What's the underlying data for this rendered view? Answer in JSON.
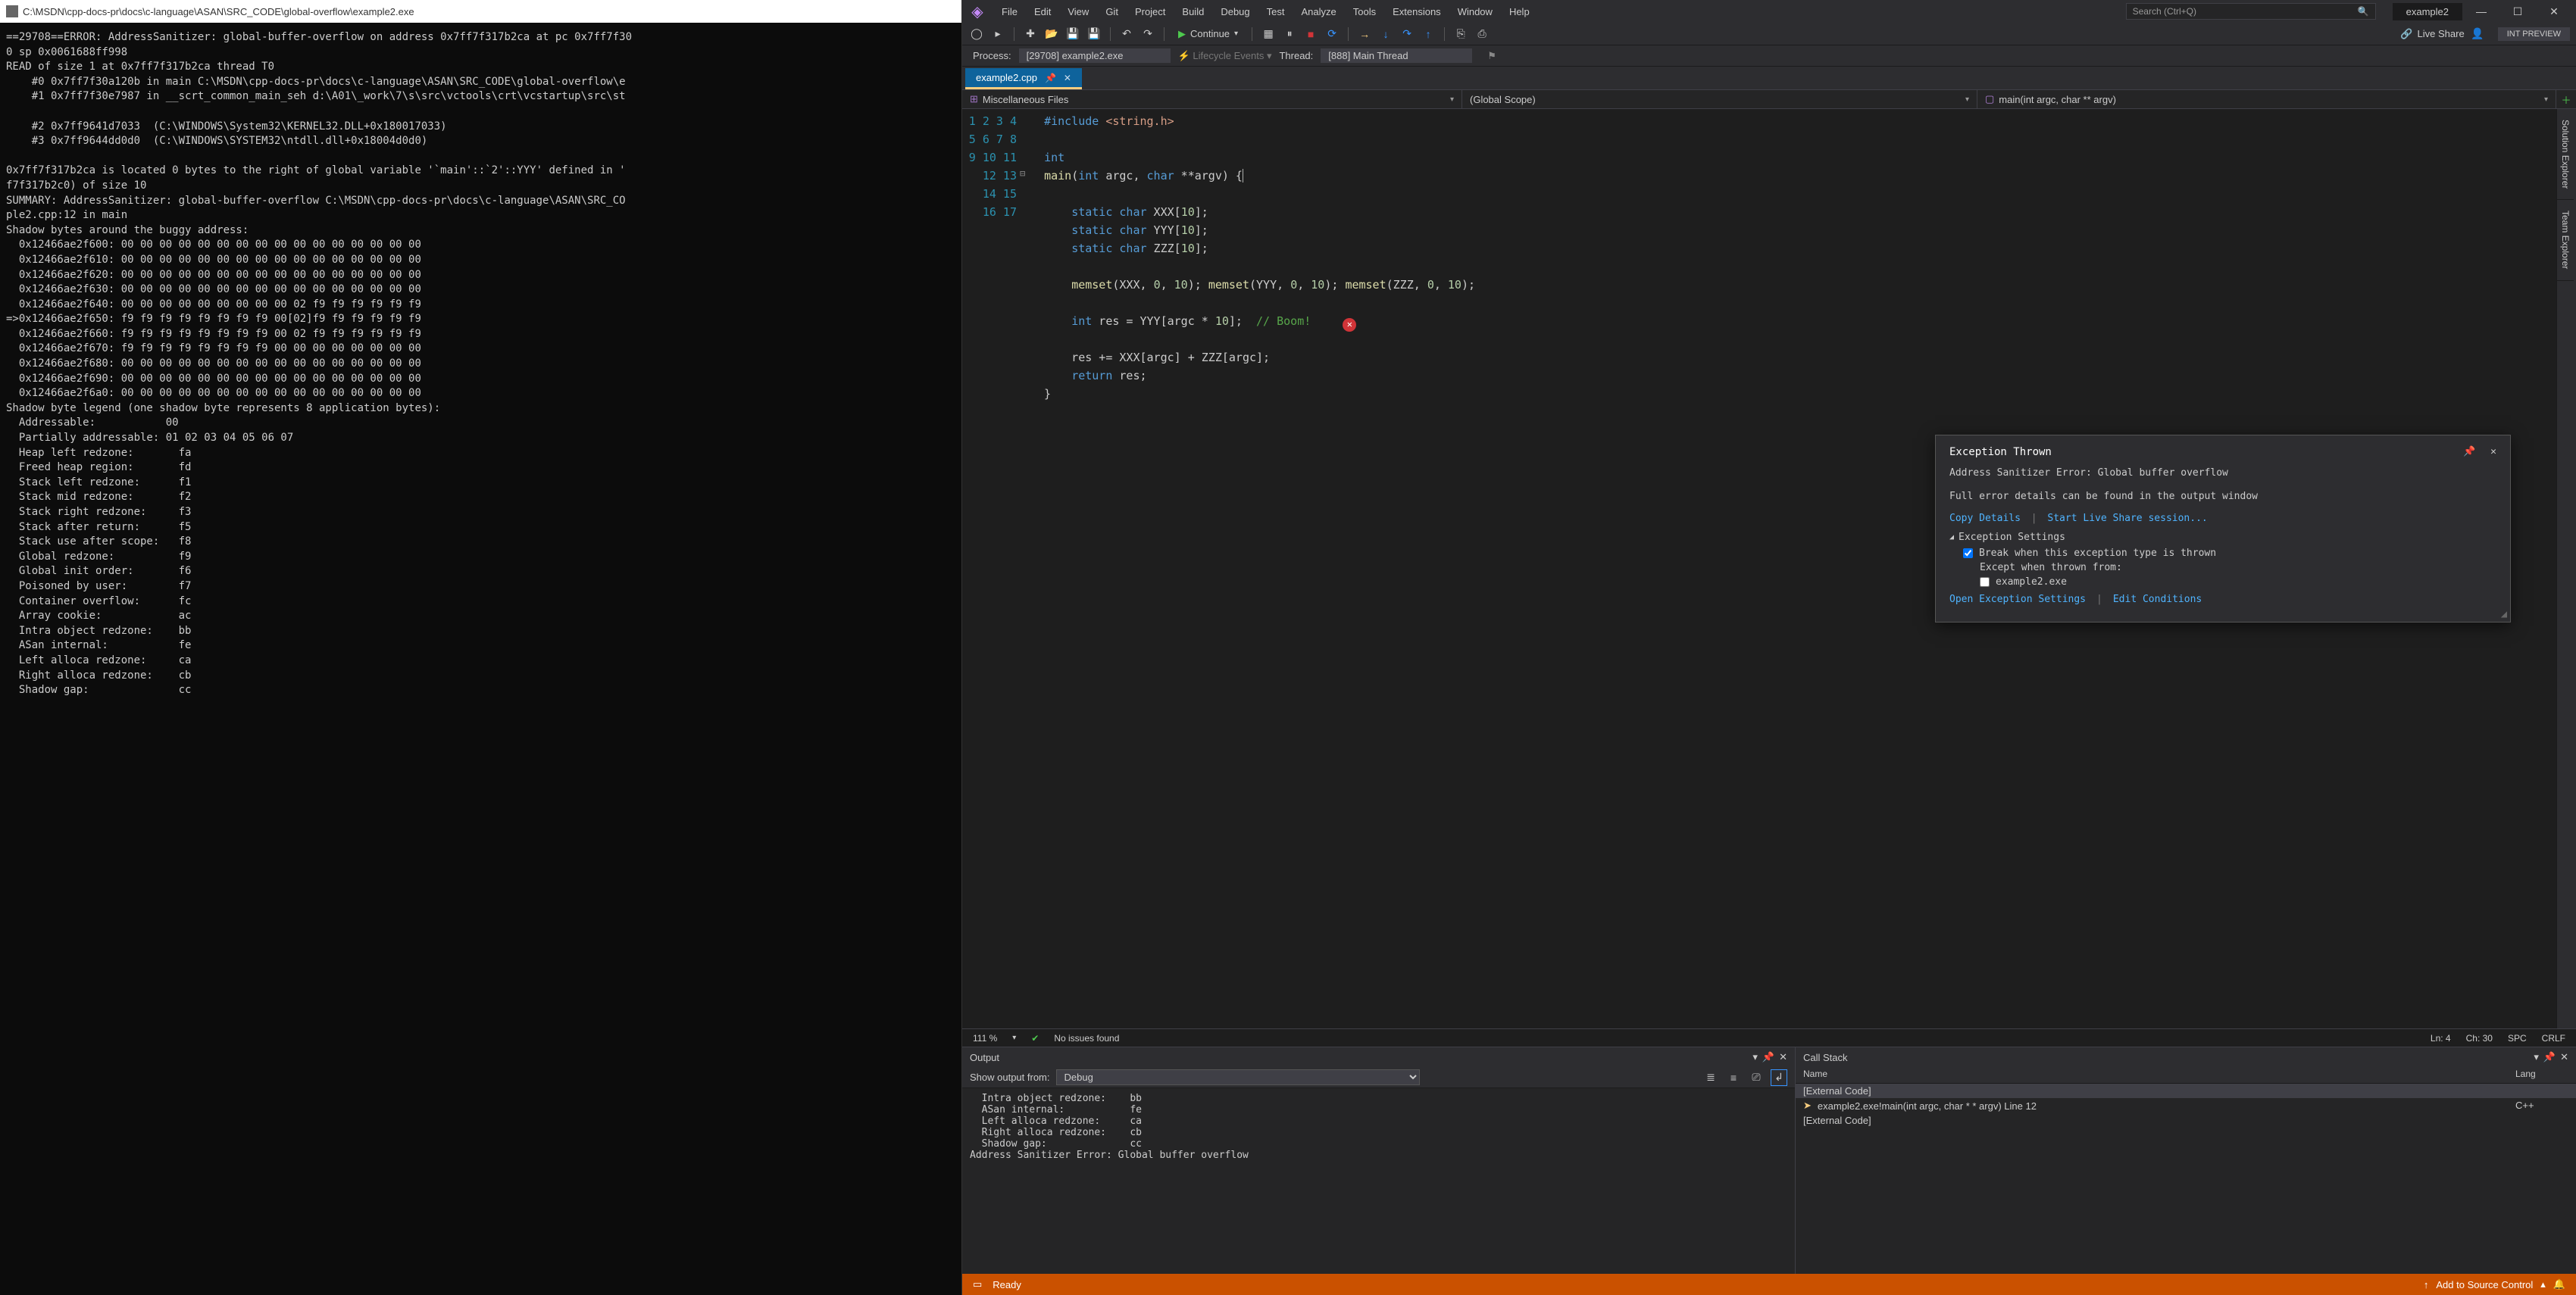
{
  "console": {
    "title": "C:\\MSDN\\cpp-docs-pr\\docs\\c-language\\ASAN\\SRC_CODE\\global-overflow\\example2.exe",
    "body": "==29708==ERROR: AddressSanitizer: global-buffer-overflow on address 0x7ff7f317b2ca at pc 0x7ff7f30\n0 sp 0x0061688ff998\nREAD of size 1 at 0x7ff7f317b2ca thread T0\n    #0 0x7ff7f30a120b in main C:\\MSDN\\cpp-docs-pr\\docs\\c-language\\ASAN\\SRC_CODE\\global-overflow\\e\n    #1 0x7ff7f30e7987 in __scrt_common_main_seh d:\\A01\\_work\\7\\s\\src\\vctools\\crt\\vcstartup\\src\\st\n\n    #2 0x7ff9641d7033  (C:\\WINDOWS\\System32\\KERNEL32.DLL+0x180017033)\n    #3 0x7ff9644dd0d0  (C:\\WINDOWS\\SYSTEM32\\ntdll.dll+0x18004d0d0)\n\n0x7ff7f317b2ca is located 0 bytes to the right of global variable '`main'::`2'::YYY' defined in '\nf7f317b2c0) of size 10\nSUMMARY: AddressSanitizer: global-buffer-overflow C:\\MSDN\\cpp-docs-pr\\docs\\c-language\\ASAN\\SRC_CO\nple2.cpp:12 in main\nShadow bytes around the buggy address:\n  0x12466ae2f600: 00 00 00 00 00 00 00 00 00 00 00 00 00 00 00 00\n  0x12466ae2f610: 00 00 00 00 00 00 00 00 00 00 00 00 00 00 00 00\n  0x12466ae2f620: 00 00 00 00 00 00 00 00 00 00 00 00 00 00 00 00\n  0x12466ae2f630: 00 00 00 00 00 00 00 00 00 00 00 00 00 00 00 00\n  0x12466ae2f640: 00 00 00 00 00 00 00 00 00 02 f9 f9 f9 f9 f9 f9\n=>0x12466ae2f650: f9 f9 f9 f9 f9 f9 f9 f9 00[02]f9 f9 f9 f9 f9 f9\n  0x12466ae2f660: f9 f9 f9 f9 f9 f9 f9 f9 00 02 f9 f9 f9 f9 f9 f9\n  0x12466ae2f670: f9 f9 f9 f9 f9 f9 f9 f9 00 00 00 00 00 00 00 00\n  0x12466ae2f680: 00 00 00 00 00 00 00 00 00 00 00 00 00 00 00 00\n  0x12466ae2f690: 00 00 00 00 00 00 00 00 00 00 00 00 00 00 00 00\n  0x12466ae2f6a0: 00 00 00 00 00 00 00 00 00 00 00 00 00 00 00 00\nShadow byte legend (one shadow byte represents 8 application bytes):\n  Addressable:           00\n  Partially addressable: 01 02 03 04 05 06 07\n  Heap left redzone:       fa\n  Freed heap region:       fd\n  Stack left redzone:      f1\n  Stack mid redzone:       f2\n  Stack right redzone:     f3\n  Stack after return:      f5\n  Stack use after scope:   f8\n  Global redzone:          f9\n  Global init order:       f6\n  Poisoned by user:        f7\n  Container overflow:      fc\n  Array cookie:            ac\n  Intra object redzone:    bb\n  ASan internal:           fe\n  Left alloca redzone:     ca\n  Right alloca redzone:    cb\n  Shadow gap:              cc"
  },
  "vs": {
    "project_title": "example2",
    "menu": [
      "File",
      "Edit",
      "View",
      "Git",
      "Project",
      "Build",
      "Debug",
      "Test",
      "Analyze",
      "Tools",
      "Extensions",
      "Window",
      "Help"
    ],
    "search_placeholder": "Search (Ctrl+Q)",
    "toolbar": {
      "continue": "Continue",
      "liveshare": "Live Share",
      "intpreview": "INT PREVIEW"
    },
    "debugbar": {
      "process_label": "Process:",
      "process_value": "[29708] example2.exe",
      "lifecycle": "Lifecycle Events",
      "thread_label": "Thread:",
      "thread_value": "[888] Main Thread"
    },
    "tab": {
      "name": "example2.cpp"
    },
    "nav": {
      "scope1": "Miscellaneous Files",
      "scope2": "(Global Scope)",
      "scope3": "main(int argc, char ** argv)"
    },
    "status": {
      "zoom": "111 %",
      "issues": "No issues found",
      "ln": "Ln: 4",
      "ch": "Ch: 30",
      "spc": "SPC",
      "crlf": "CRLF"
    },
    "sidetabs": [
      "Solution Explorer",
      "Team Explorer"
    ]
  },
  "editor": {
    "line_count": 17
  },
  "exception": {
    "title": "Exception Thrown",
    "message": "Address Sanitizer Error: Global buffer overflow",
    "detail": "Full error details can be found in the output window",
    "copy": "Copy Details",
    "startls": "Start Live Share session...",
    "settings_head": "Exception Settings",
    "break_label": "Break when this exception type is thrown",
    "except_label": "Except when thrown from:",
    "except_item": "example2.exe",
    "open_settings": "Open Exception Settings",
    "edit_cond": "Edit Conditions"
  },
  "output": {
    "title": "Output",
    "show_from": "Show output from:",
    "source": "Debug",
    "body": "  Intra object redzone:    bb\n  ASan internal:           fe\n  Left alloca redzone:     ca\n  Right alloca redzone:    cb\n  Shadow gap:              cc\nAddress Sanitizer Error: Global buffer overflow"
  },
  "callstack": {
    "title": "Call Stack",
    "col_name": "Name",
    "col_lang": "Lang",
    "rows": [
      {
        "name": "[External Code]",
        "lang": ""
      },
      {
        "name": "example2.exe!main(int argc, char * * argv) Line 12",
        "lang": "C++"
      },
      {
        "name": "[External Code]",
        "lang": ""
      }
    ]
  },
  "vsstatus": {
    "ready": "Ready",
    "add_source": "Add to Source Control"
  }
}
